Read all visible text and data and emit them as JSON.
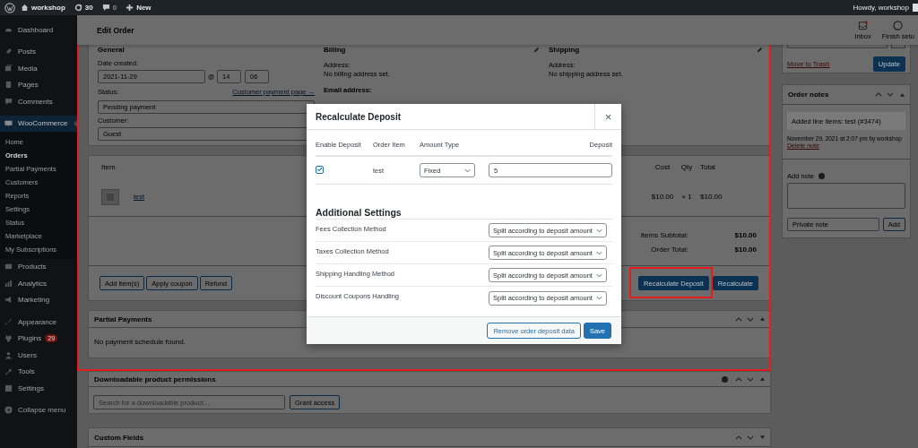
{
  "admin_bar": {
    "site": "workshop",
    "updates": "30",
    "comments": "0",
    "new": "New",
    "greeting": "Howdy, workshop"
  },
  "sidebar": {
    "groups": [
      {
        "items": [
          {
            "label": "Dashboard",
            "selected": false
          }
        ]
      },
      {
        "items": [
          {
            "label": "Posts",
            "selected": false
          },
          {
            "label": "Media",
            "selected": false
          },
          {
            "label": "Pages",
            "selected": false
          },
          {
            "label": "Comments",
            "selected": false
          }
        ]
      },
      {
        "items": [
          {
            "label": "WooCommerce",
            "selected": true,
            "children": [
              {
                "label": "Home",
                "selected": false
              },
              {
                "label": "Orders",
                "selected": true
              },
              {
                "label": "Partial Payments",
                "selected": false
              },
              {
                "label": "Customers",
                "selected": false
              },
              {
                "label": "Reports",
                "selected": false
              },
              {
                "label": "Settings",
                "selected": false
              },
              {
                "label": "Status",
                "selected": false
              },
              {
                "label": "Marketplace",
                "selected": false
              },
              {
                "label": "My Subscriptions",
                "selected": false
              }
            ]
          },
          {
            "label": "Products",
            "selected": false
          },
          {
            "label": "Analytics",
            "selected": false
          },
          {
            "label": "Marketing",
            "selected": false
          }
        ]
      },
      {
        "items": [
          {
            "label": "Appearance",
            "selected": false
          },
          {
            "label": "Plugins",
            "selected": false,
            "badge": "29"
          },
          {
            "label": "Users",
            "selected": false
          },
          {
            "label": "Tools",
            "selected": false
          },
          {
            "label": "Settings",
            "selected": false
          }
        ]
      }
    ],
    "collapse": "Collapse menu"
  },
  "header": {
    "title": "Edit Order",
    "actions": [
      {
        "label": "Inbox",
        "kind": "inbox",
        "unread": true
      },
      {
        "label": "Finish setu",
        "kind": "setup"
      }
    ]
  },
  "order": {
    "general": {
      "heading": "General",
      "date_label": "Date created:",
      "date": "2021-11-29",
      "at": "@",
      "hour": "14",
      "minute": "06",
      "status_label": "Status:",
      "payment_link": "Customer payment page →",
      "status": "Pending payment",
      "customer_label": "Customer:",
      "customer": "Guest"
    },
    "billing": {
      "heading": "Billing",
      "address_label": "Address:",
      "address": "No billing address set.",
      "email_label": "Email address:"
    },
    "shipping": {
      "heading": "Shipping",
      "address_label": "Address:",
      "address": "No shipping address set."
    }
  },
  "items": {
    "columns": [
      "Item",
      "Cost",
      "Qty",
      "Total"
    ],
    "rows": [
      {
        "name": "test",
        "cost": "$10.00",
        "qty": "× 1",
        "total": "$10.00"
      }
    ],
    "totals": [
      {
        "label": "Items Subtotal:",
        "value": "$10.00"
      },
      {
        "label": "Order Total:",
        "value": "$10.00"
      }
    ],
    "left_buttons": [
      "Add item(s)",
      "Apply coupon",
      "Refund"
    ],
    "right_buttons": [
      {
        "label": "Recalculate Deposit",
        "highlighted": true
      },
      {
        "label": "Recalculate",
        "highlighted": false
      }
    ]
  },
  "partial_payments": {
    "title": "Partial Payments",
    "message": "No payment schedule found."
  },
  "downloads": {
    "title": "Downloadable product permissions",
    "placeholder": "Search for a downloadable product…",
    "button": "Grant access"
  },
  "custom_fields": {
    "title": "Custom Fields"
  },
  "actions_box": {
    "trash": "Move to Trash",
    "update": "Update"
  },
  "order_notes": {
    "title": "Order notes",
    "notes": [
      {
        "text": "Added line items: test (#3474)",
        "meta": "November 29, 2021 at 2:07 pm by workshop",
        "delete": "Delete note"
      }
    ],
    "add_label": "Add note",
    "note_type": "Private note",
    "add": "Add"
  },
  "modal": {
    "title": "Recalculate Deposit",
    "close": "×",
    "columns": [
      "Enable Deposit",
      "Order Item",
      "Amount Type",
      "Deposit"
    ],
    "rows": [
      {
        "checked": true,
        "item": "test",
        "amount_type": "Fixed",
        "deposit": "5"
      }
    ],
    "settings_heading": "Additional Settings",
    "settings": [
      {
        "label": "Fees Collection Method",
        "value": "Split according to deposit amount"
      },
      {
        "label": "Taxes Collection Method",
        "value": "Split according to deposit amount"
      },
      {
        "label": "Shipping Handling Method",
        "value": "Split according to deposit amount"
      },
      {
        "label": "Discount Coupons Handling",
        "value": "Split according to deposit amount"
      }
    ],
    "buttons": [
      {
        "label": "Remove order deposit data",
        "kind": "secondary"
      },
      {
        "label": "Save",
        "kind": "primary"
      }
    ]
  },
  "annotations": {
    "content_frame": true
  }
}
